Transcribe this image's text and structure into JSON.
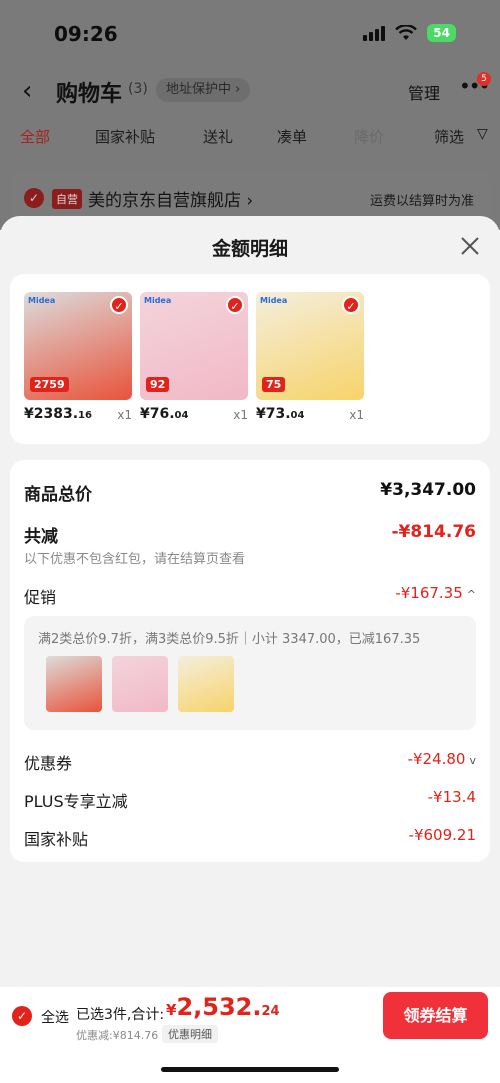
{
  "status_bar": {
    "time": "09:26",
    "battery": "54"
  },
  "cart_header": {
    "back_icon": "‹",
    "title": "购物车",
    "count": "(3)",
    "address_protect": "地址保护中 ›",
    "manage": "管理",
    "more_icon": "•••",
    "more_badge": "5"
  },
  "tabs": [
    {
      "label": "全部",
      "state": "active"
    },
    {
      "label": "国家补贴"
    },
    {
      "label": "送礼"
    },
    {
      "label": "凑单"
    },
    {
      "label": "降价",
      "state": "disabled"
    },
    {
      "label": "筛选"
    }
  ],
  "store": {
    "self_badge": "自营",
    "name": "美的京东自营旗舰店 ›",
    "shipping_note": "运费以结算时为准"
  },
  "sheet": {
    "title": "金额明细"
  },
  "products": [
    {
      "brand": "Midea",
      "tag": "2759",
      "price_int": "¥2383.",
      "price_dec": "16",
      "qty": "x1",
      "color": "#dcdcdc",
      "accent": "#e8533a"
    },
    {
      "brand": "Midea",
      "tag": "92",
      "price_int": "¥76.",
      "price_dec": "04",
      "qty": "x1",
      "color": "#f3d4dc",
      "accent": "#f2b8c6"
    },
    {
      "brand": "Midea",
      "tag": "75",
      "price_int": "¥73.",
      "price_dec": "04",
      "qty": "x1",
      "color": "#f4eedd",
      "accent": "#f7d36a"
    }
  ],
  "summary": {
    "total_label": "商品总价",
    "total_value": "¥3,347.00",
    "reduced_label": "共减",
    "reduced_value": "-¥814.76",
    "reduced_note": "以下优惠不包含红包，请在结算页查看",
    "promo_label": "促销",
    "promo_value": "-¥167.35",
    "promo_chevron": "^",
    "promo_text": "满2类总价9.7折，满3类总价9.5折｜小计 3347.00，已减167.35",
    "coupon_label": "优惠券",
    "coupon_value": "-¥24.80",
    "coupon_chevron": "v",
    "plus_label": "PLUS专享立减",
    "plus_value": "-¥13.4",
    "subsidy_label": "国家补贴",
    "subsidy_value": "-¥609.21"
  },
  "bottom_bar": {
    "select_all": "全选",
    "selected_text": "已选3件,合计:",
    "total_currency": "¥",
    "total_int": "2,532.",
    "total_dec": "24",
    "discount_line": "优惠减:¥814.76",
    "detail_pill": "优惠明细",
    "checkout": "领券结算"
  },
  "colors": {
    "accent": "#e2231a",
    "checkout_button": "#f0313a"
  }
}
